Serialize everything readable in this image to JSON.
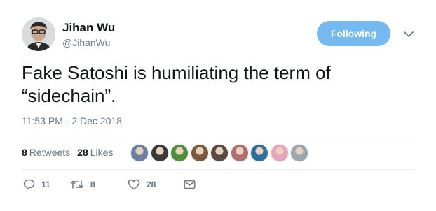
{
  "author": {
    "display_name": "Jihan Wu",
    "username": "@JihanWu"
  },
  "follow_button": {
    "label": "Following",
    "color": "#74b9ef"
  },
  "tweet": {
    "text_line1": "Fake Satoshi is humiliating the term of",
    "text_line2": "“sidechain”.",
    "timestamp": "11:53 PM - 2 Dec 2018"
  },
  "stats": {
    "retweets_count": "8",
    "retweets_label": "Retweets",
    "likes_count": "28",
    "likes_label": "Likes"
  },
  "likers": [
    {
      "name": "liker-1",
      "color": "#6b7fa3"
    },
    {
      "name": "liker-2",
      "color": "#3a3a3a"
    },
    {
      "name": "liker-3",
      "color": "#4d8f3a"
    },
    {
      "name": "liker-4",
      "color": "#7a5a3c"
    },
    {
      "name": "liker-5",
      "color": "#5a4a42"
    },
    {
      "name": "liker-6",
      "color": "#b07070"
    },
    {
      "name": "liker-7",
      "color": "#2f6f9f"
    },
    {
      "name": "liker-8",
      "color": "#e4a6b8"
    },
    {
      "name": "liker-9",
      "color": "#9aa7b0"
    }
  ],
  "actions": {
    "reply_count": "11",
    "retweet_count": "8",
    "like_count": "28"
  },
  "icons": [
    "chevron-down-icon",
    "reply-icon",
    "retweet-icon",
    "heart-icon",
    "envelope-icon"
  ]
}
